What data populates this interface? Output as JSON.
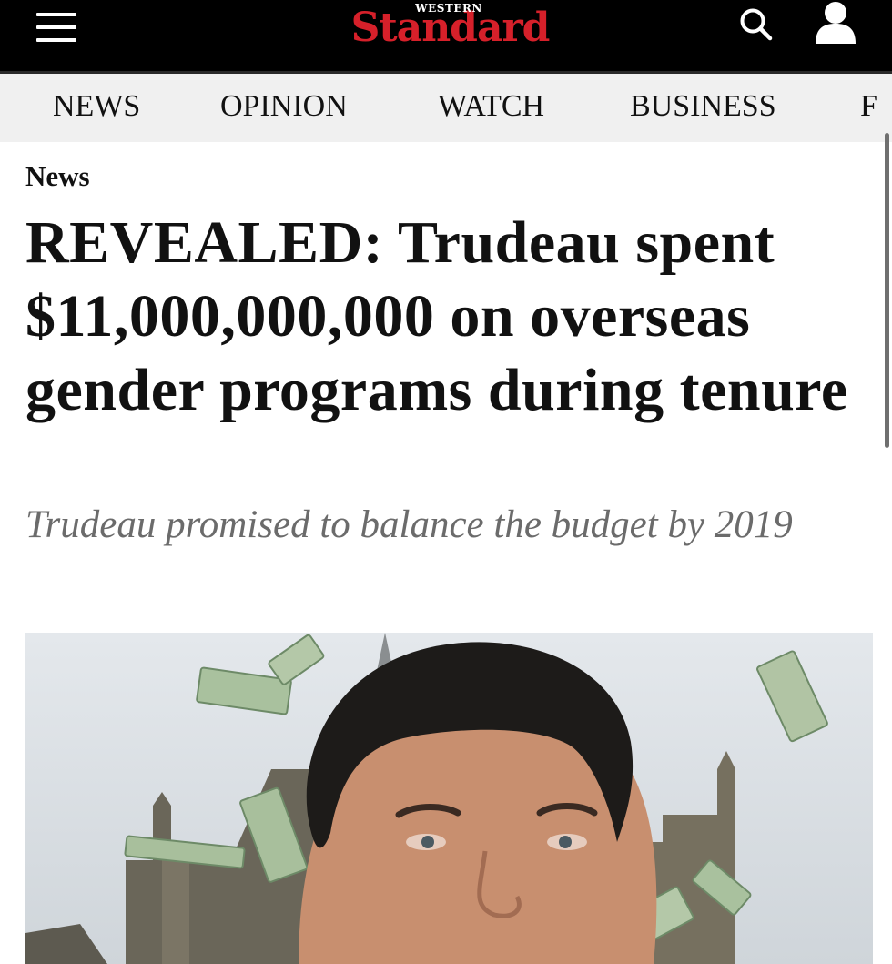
{
  "header": {
    "logo_top": "WESTERN",
    "logo_main": "Standard",
    "brand_color": "#d6202a"
  },
  "nav": {
    "items": [
      "NEWS",
      "OPINION",
      "WATCH",
      "BUSINESS",
      "F"
    ]
  },
  "article": {
    "section": "News",
    "headline": "REVEALED: Trudeau spent $11,000,000,000 on overseas gender programs during tenure",
    "subheadline": "Trudeau promised to balance the budget by 2019"
  },
  "icons": {
    "menu": "hamburger-menu-icon",
    "search": "search-icon",
    "account": "user-icon"
  }
}
